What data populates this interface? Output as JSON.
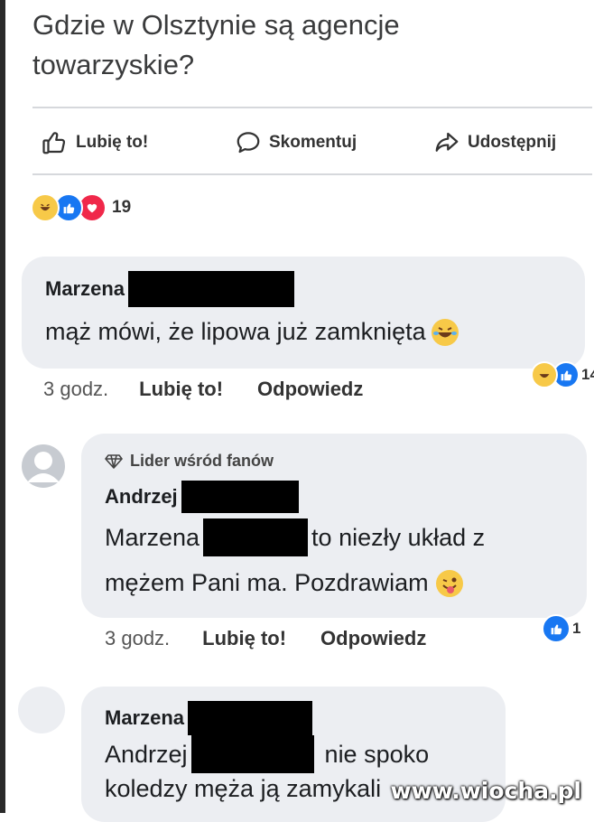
{
  "post": {
    "text": "Gdzie w Olsztynie są agencje towarzyskie?",
    "actions": {
      "like_label": "Lubię to!",
      "comment_label": "Skomentuj",
      "share_label": "Udostępnij"
    },
    "reactions": {
      "icons": [
        "haha",
        "like",
        "love"
      ],
      "count": "19"
    }
  },
  "comments": [
    {
      "author": "Marzena",
      "text": "mąż mówi, że lipowa już zamknięta",
      "time": "3 godz.",
      "like_label": "Lubię to!",
      "reply_label": "Odpowiedz",
      "reactions": {
        "icons": [
          "haha",
          "like"
        ],
        "count": "14"
      }
    },
    {
      "badge": "Lider wśród fanów",
      "author": "Andrzej",
      "text_part1": "Marzena",
      "text_part2": "to niezły układ z",
      "text_line2": "mężem Pani ma. Pozdrawiam",
      "time": "3 godz.",
      "like_label": "Lubię to!",
      "reply_label": "Odpowiedz",
      "reactions": {
        "icons": [
          "like"
        ],
        "count": "1"
      }
    },
    {
      "author": "Marzena",
      "text_part1": "Andrzej",
      "text_part2": "nie spoko",
      "text_line2": "koledzy męża ją zamykali"
    }
  ],
  "watermark": "www.wiocha.pl",
  "colors": {
    "bubble": "#eceef2",
    "like_blue": "#1877f2",
    "love_red": "#f0284a",
    "haha_yellow": "#f7c948",
    "redaction": "#000000"
  }
}
